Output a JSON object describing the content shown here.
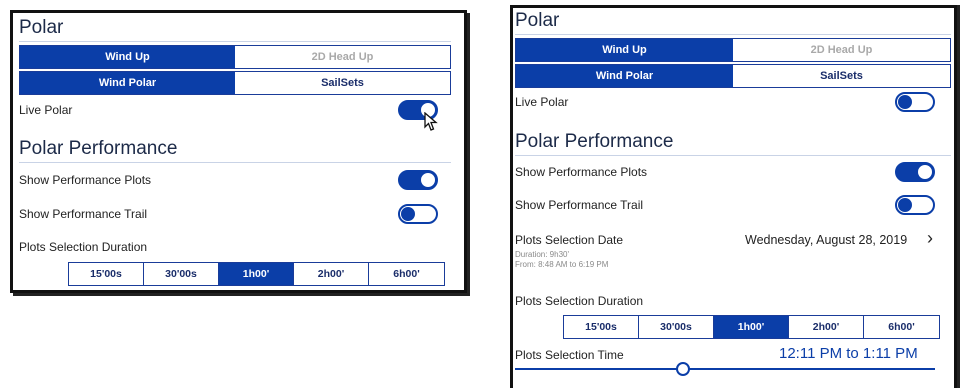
{
  "left": {
    "polar_title": "Polar",
    "tabs_row1": [
      {
        "label": "Wind Up",
        "state": "on"
      },
      {
        "label": "2D Head Up",
        "state": "dim"
      }
    ],
    "tabs_row2": [
      {
        "label": "Wind Polar",
        "state": "on"
      },
      {
        "label": "SailSets",
        "state": "off"
      }
    ],
    "live_polar_label": "Live Polar",
    "live_polar_on": true,
    "perf_title": "Polar Performance",
    "show_plots_label": "Show Performance Plots",
    "show_plots_on": true,
    "show_trail_label": "Show Performance Trail",
    "show_trail_on": false,
    "duration_label": "Plots Selection Duration",
    "durations": [
      "15'00s",
      "30'00s",
      "1h00'",
      "2h00'",
      "6h00'"
    ],
    "duration_selected": "1h00'"
  },
  "right": {
    "polar_title": "Polar",
    "tabs_row1": [
      {
        "label": "Wind Up",
        "state": "on"
      },
      {
        "label": "2D Head Up",
        "state": "dim"
      }
    ],
    "tabs_row2": [
      {
        "label": "Wind Polar",
        "state": "on"
      },
      {
        "label": "SailSets",
        "state": "off"
      }
    ],
    "live_polar_label": "Live Polar",
    "live_polar_on": false,
    "perf_title": "Polar Performance",
    "show_plots_label": "Show Performance Plots",
    "show_plots_on": true,
    "show_trail_label": "Show Performance Trail",
    "show_trail_on": false,
    "date_label": "Plots Selection Date",
    "date_value": "Wednesday, August 28, 2019",
    "date_chevron": "›",
    "duration_info": "Duration: 9h30'",
    "from_info": "From: 8:48 AM to 6:19 PM",
    "duration_label": "Plots Selection Duration",
    "durations": [
      "15'00s",
      "30'00s",
      "1h00'",
      "2h00'",
      "6h00'"
    ],
    "duration_selected": "1h00'",
    "time_label": "Plots Selection Time",
    "time_value": "12:11 PM to 1:11 PM",
    "time_slider_fraction": 0.4
  },
  "colors": {
    "accent": "#0b3ea8",
    "text": "#1c2a48",
    "muted": "#a9a9a9"
  },
  "icons": {
    "cursor": "mouse-pointer-icon",
    "chevron": "chevron-right-icon"
  }
}
